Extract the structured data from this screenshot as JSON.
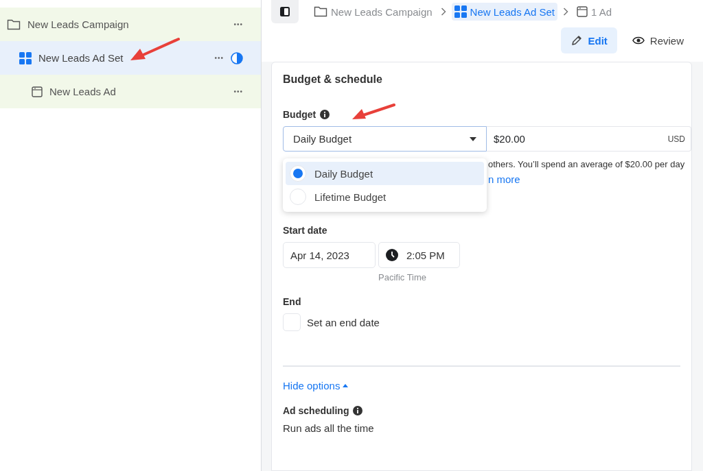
{
  "tree": [
    {
      "kind": "campaign",
      "label": "New Leads Campaign",
      "selected": false,
      "more": "•••"
    },
    {
      "kind": "adset",
      "label": "New Leads Ad Set",
      "selected": true,
      "more": "•••"
    },
    {
      "kind": "ad",
      "label": "New Leads Ad",
      "selected": false,
      "more": "•••"
    }
  ],
  "breadcrumb": [
    {
      "kind": "campaign",
      "label": "New Leads Campaign",
      "selected": false
    },
    {
      "kind": "adset",
      "label": "New Leads Ad Set",
      "selected": true
    },
    {
      "kind": "ad",
      "label": "1 Ad",
      "selected": false
    }
  ],
  "modes": [
    {
      "kind": "edit",
      "label": "Edit",
      "selected": true
    },
    {
      "kind": "review",
      "label": "Review",
      "selected": false
    }
  ],
  "card": {
    "title": "Budget & schedule",
    "budget": {
      "label": "Budget",
      "type_value": "Daily Budget",
      "amount": "$20.00",
      "currency": "USD",
      "options": [
        {
          "label": "Daily Budget",
          "selected": true
        },
        {
          "label": "Lifetime Budget",
          "selected": false
        }
      ],
      "help_text": "others. You’ll spend an average of $20.00 per day",
      "help_link": "n more"
    },
    "start": {
      "label": "Start date",
      "date": "Apr 14, 2023",
      "time": "2:05 PM",
      "timezone": "Pacific Time"
    },
    "end": {
      "label": "End",
      "checkbox_label": "Set an end date",
      "checked": false
    },
    "toggle": "Hide options",
    "ad_scheduling": {
      "label": "Ad scheduling",
      "value": "Run ads all the time"
    }
  }
}
